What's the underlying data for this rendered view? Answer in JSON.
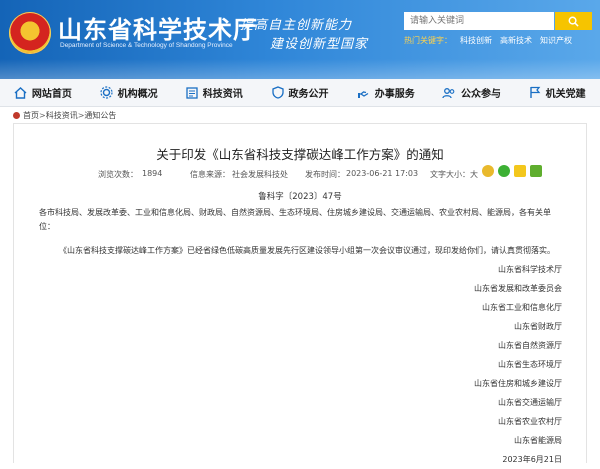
{
  "header": {
    "site_title": "山东省科学技术厅",
    "site_subtitle": "Department of Science & Technology of Shandong Province",
    "slogan_line1": "提高自主创新能力",
    "slogan_line2": "建设创新型国家",
    "search_placeholder": "请输入关键词",
    "hot_words": [
      "热门关键字：",
      "科技创新",
      "高新技术",
      "知识产权"
    ]
  },
  "nav": {
    "items": [
      {
        "label": "网站首页",
        "icon": "home-icon"
      },
      {
        "label": "机构概况",
        "icon": "gear-icon"
      },
      {
        "label": "科技资讯",
        "icon": "newspaper-icon"
      },
      {
        "label": "政务公开",
        "icon": "shield-icon"
      },
      {
        "label": "办事服务",
        "icon": "hand-icon"
      },
      {
        "label": "公众参与",
        "icon": "people-icon"
      },
      {
        "label": "机关党建",
        "icon": "flag-icon"
      }
    ]
  },
  "breadcrumb": {
    "home": "首页",
    "section": "科技资讯",
    "current": "通知公告",
    "separator": ">"
  },
  "article": {
    "title": "关于印发《山东省科技支撑碳达峰工作方案》的通知",
    "views_label": "浏览次数：",
    "views": "1894",
    "source_label": "信息来源：",
    "source": "社会发展科技处",
    "date_label": "发布时间：",
    "date": "2023-06-21 17:03",
    "font_size_label": "文字大小：",
    "font_size_large": "大",
    "doc_number": "鲁科字〔2023〕47号",
    "recipients": "各市科技局、发展改革委、工业和信息化局、财政局、自然资源局、生态环境局、住房城乡建设局、交通运输局、农业农村局、能源局，各有关单位：",
    "body": "《山东省科技支撑碳达峰工作方案》已经省绿色低碳高质量发展先行区建设领导小组第一次会议审议通过，现印发给你们，请认真贯彻落实。",
    "signers": [
      "山东省科学技术厅",
      "山东省发展和改革委员会",
      "山东省工业和信息化厅",
      "山东省财政厅",
      "山东省自然资源厅",
      "山东省生态环境厅",
      "山东省住房和城乡建设厅",
      "山东省交通运输厅",
      "山东省农业农村厅",
      "山东省能源局",
      "2023年6月21日"
    ]
  },
  "colors": {
    "header_blue": "#1a6fc4",
    "search_button": "#f6c400",
    "nav_bg": "#f4f6f9"
  }
}
